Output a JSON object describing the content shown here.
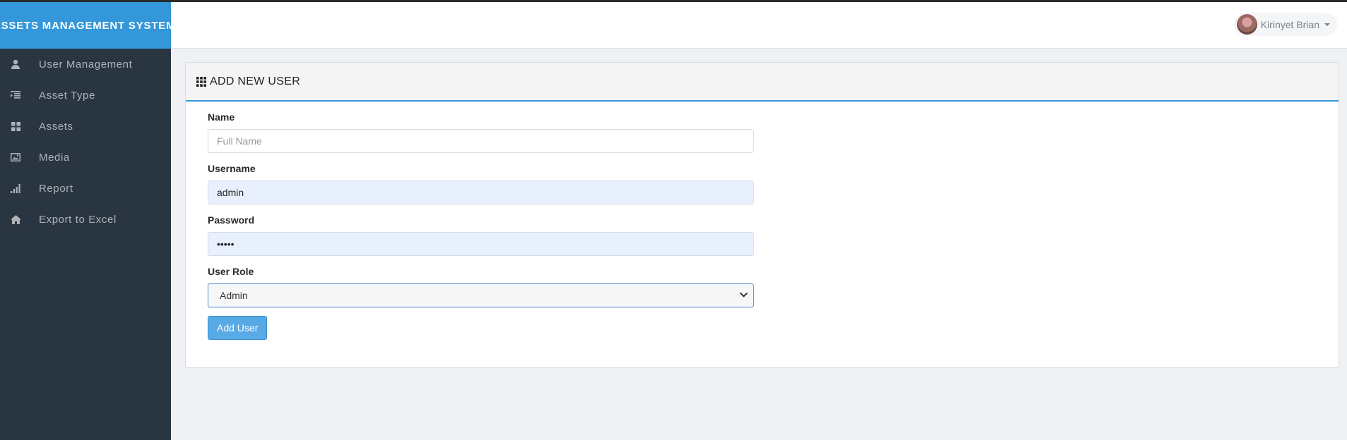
{
  "app": {
    "brand": "ASSETS MANAGEMENT SYSTEM"
  },
  "sidebar": {
    "items": [
      {
        "label": "User Management",
        "icon": "user-icon"
      },
      {
        "label": "Asset Type",
        "icon": "indent-list-icon"
      },
      {
        "label": "Assets",
        "icon": "grid-icon"
      },
      {
        "label": "Media",
        "icon": "picture-icon"
      },
      {
        "label": "Report",
        "icon": "signal-bars-icon"
      },
      {
        "label": "Export to Excel",
        "icon": "home-icon"
      }
    ]
  },
  "header": {
    "user_name": "Kirinyet Brian"
  },
  "panel": {
    "title": "ADD NEW USER",
    "title_icon": "th-grid-icon"
  },
  "form": {
    "name": {
      "label": "Name",
      "placeholder": "Full Name",
      "value": ""
    },
    "username": {
      "label": "Username",
      "value": "admin"
    },
    "password": {
      "label": "Password",
      "value": "•••••"
    },
    "role": {
      "label": "User Role",
      "selected": "Admin"
    },
    "submit_label": "Add User"
  },
  "colors": {
    "sidebar_bg": "#2a3542",
    "brand_bg": "#3397d9",
    "accent": "#3397d9",
    "button_bg": "#58aae7",
    "autofill_bg": "#e8f0fe",
    "page_bg": "#eff1f5"
  }
}
